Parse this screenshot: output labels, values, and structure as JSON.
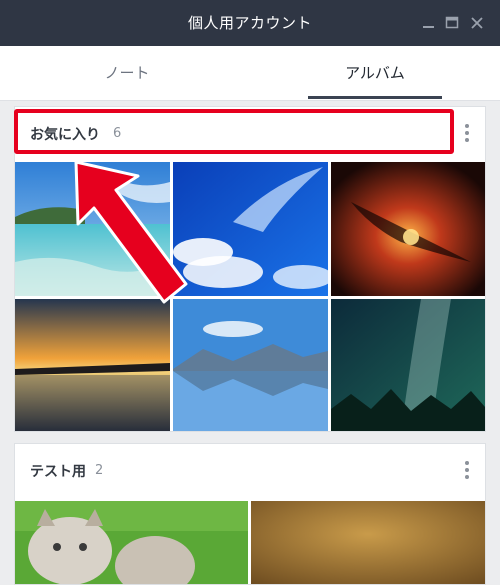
{
  "window": {
    "title": "個人用アカウント",
    "controls": [
      "minimize-icon",
      "maximize-icon",
      "close-icon"
    ]
  },
  "tabs": [
    {
      "label": "ノート",
      "selected": false
    },
    {
      "label": "アルバム",
      "selected": true
    }
  ],
  "albums": [
    {
      "name": "お気に入り",
      "count": "6",
      "photos": [
        "beach-lagoon",
        "blue-sky-clouds",
        "fiery-nebula",
        "sunset-lake",
        "mountain-lake-reflection",
        "milky-way-forest"
      ]
    },
    {
      "name": "テスト用",
      "count": "2",
      "photos": [
        "kittens-on-grass",
        "gold-texture"
      ]
    }
  ],
  "annotation": {
    "highlight_color": "#e6001e",
    "arrow_icon": "red-pointer-arrow-icon"
  },
  "colors": {
    "titlebar": "#2f3644",
    "background": "#ecedef",
    "accent": "#e6001e"
  }
}
